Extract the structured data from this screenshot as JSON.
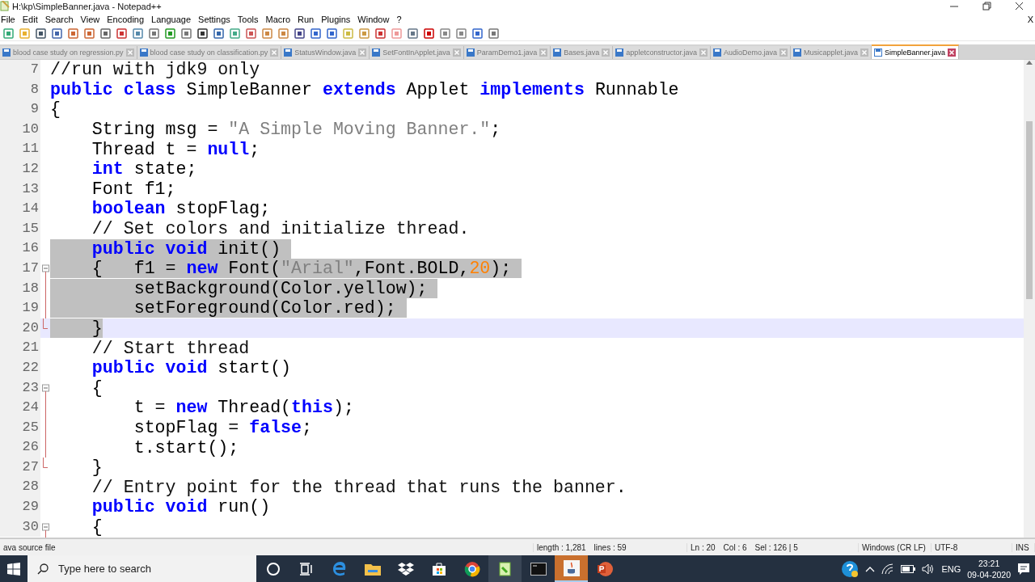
{
  "window": {
    "title": "H:\\kp\\SimpleBanner.java - Notepad++"
  },
  "menu": [
    "File",
    "Edit",
    "Search",
    "View",
    "Encoding",
    "Language",
    "Settings",
    "Tools",
    "Macro",
    "Run",
    "Plugins",
    "Window",
    "?"
  ],
  "doc_close": "X",
  "tabs": [
    {
      "label": "blood case study on regression.py",
      "selected": false
    },
    {
      "label": "blood case study on classification.py",
      "selected": false
    },
    {
      "label": "StatusWindow.java",
      "selected": false
    },
    {
      "label": "SetFontInApplet.java",
      "selected": false
    },
    {
      "label": "ParamDemo1.java",
      "selected": false
    },
    {
      "label": "Bases.java",
      "selected": false
    },
    {
      "label": "appletconstructor.java",
      "selected": false
    },
    {
      "label": "AudioDemo.java",
      "selected": false
    },
    {
      "label": "Musicapplet.java",
      "selected": false
    },
    {
      "label": "SimpleBanner.java",
      "selected": true
    }
  ],
  "lines": [
    {
      "number": "7",
      "selected": false,
      "tokens": [
        {
          "kind": "comment",
          "text": "//run with jdk9 only"
        }
      ]
    },
    {
      "number": "8",
      "selected": false,
      "tokens": [
        {
          "kind": "kw",
          "text": "public class "
        },
        {
          "kind": "plain",
          "text": "SimpleBanner "
        },
        {
          "kind": "kw",
          "text": "extends "
        },
        {
          "kind": "plain",
          "text": "Applet "
        },
        {
          "kind": "kw",
          "text": "implements "
        },
        {
          "kind": "plain",
          "text": "Runnable"
        }
      ]
    },
    {
      "number": "9",
      "selected": false,
      "tokens": [
        {
          "kind": "plain",
          "text": "{"
        }
      ]
    },
    {
      "number": "10",
      "selected": false,
      "tokens": [
        {
          "kind": "plain",
          "text": "    String msg = "
        },
        {
          "kind": "str",
          "text": "\"A Simple Moving Banner.\""
        },
        {
          "kind": "plain",
          "text": ";"
        }
      ]
    },
    {
      "number": "11",
      "selected": false,
      "tokens": [
        {
          "kind": "plain",
          "text": "    Thread t = "
        },
        {
          "kind": "kw",
          "text": "null"
        },
        {
          "kind": "plain",
          "text": ";"
        }
      ]
    },
    {
      "number": "12",
      "selected": false,
      "tokens": [
        {
          "kind": "kw",
          "text": "    int "
        },
        {
          "kind": "plain",
          "text": "state;"
        }
      ]
    },
    {
      "number": "13",
      "selected": false,
      "tokens": [
        {
          "kind": "plain",
          "text": "    Font f1;"
        }
      ]
    },
    {
      "number": "14",
      "selected": false,
      "tokens": [
        {
          "kind": "kw",
          "text": "    boolean "
        },
        {
          "kind": "plain",
          "text": "stopFlag;"
        }
      ]
    },
    {
      "number": "15",
      "selected": false,
      "tokens": [
        {
          "kind": "comment",
          "text": "    // Set colors and initialize thread."
        }
      ]
    },
    {
      "number": "16",
      "selected": true,
      "tokens": [
        {
          "kind": "kw",
          "text": "    public void "
        },
        {
          "kind": "plain",
          "text": "init() "
        }
      ]
    },
    {
      "number": "17",
      "selected": true,
      "fold_start": true,
      "tokens": [
        {
          "kind": "plain",
          "text": "    {   f1 = "
        },
        {
          "kind": "kw",
          "text": "new "
        },
        {
          "kind": "plain",
          "text": "Font("
        },
        {
          "kind": "str",
          "text": "\"Arial\""
        },
        {
          "kind": "plain",
          "text": ",Font.BOLD,"
        },
        {
          "kind": "num",
          "text": "20"
        },
        {
          "kind": "plain",
          "text": "); "
        }
      ]
    },
    {
      "number": "18",
      "selected": true,
      "in_fold": true,
      "tokens": [
        {
          "kind": "plain",
          "text": "        setBackground(Color.yellow); "
        }
      ]
    },
    {
      "number": "19",
      "selected": true,
      "in_fold": true,
      "tokens": [
        {
          "kind": "plain",
          "text": "        setForeground(Color.red); "
        }
      ]
    },
    {
      "number": "20",
      "selected": true,
      "current": true,
      "fold_end": true,
      "tokens": [
        {
          "kind": "plain",
          "text": "    }"
        }
      ]
    },
    {
      "number": "21",
      "selected": false,
      "tokens": [
        {
          "kind": "comment",
          "text": "    // Start thread"
        }
      ]
    },
    {
      "number": "22",
      "selected": false,
      "tokens": [
        {
          "kind": "kw",
          "text": "    public void "
        },
        {
          "kind": "plain",
          "text": "start()"
        }
      ]
    },
    {
      "number": "23",
      "selected": false,
      "fold_start": true,
      "tokens": [
        {
          "kind": "plain",
          "text": "    {"
        }
      ]
    },
    {
      "number": "24",
      "selected": false,
      "in_fold": true,
      "tokens": [
        {
          "kind": "plain",
          "text": "        t = "
        },
        {
          "kind": "kw",
          "text": "new "
        },
        {
          "kind": "plain",
          "text": "Thread("
        },
        {
          "kind": "kw",
          "text": "this"
        },
        {
          "kind": "plain",
          "text": ");"
        }
      ]
    },
    {
      "number": "25",
      "selected": false,
      "in_fold": true,
      "tokens": [
        {
          "kind": "plain",
          "text": "        stopFlag = "
        },
        {
          "kind": "kw",
          "text": "false"
        },
        {
          "kind": "plain",
          "text": ";"
        }
      ]
    },
    {
      "number": "26",
      "selected": false,
      "in_fold": true,
      "tokens": [
        {
          "kind": "plain",
          "text": "        t.start();"
        }
      ]
    },
    {
      "number": "27",
      "selected": false,
      "fold_end": true,
      "tokens": [
        {
          "kind": "plain",
          "text": "    }"
        }
      ]
    },
    {
      "number": "28",
      "selected": false,
      "tokens": [
        {
          "kind": "comment",
          "text": "    // Entry point for the thread that runs the banner."
        }
      ]
    },
    {
      "number": "29",
      "selected": false,
      "tokens": [
        {
          "kind": "kw",
          "text": "    public void "
        },
        {
          "kind": "plain",
          "text": "run()"
        }
      ]
    },
    {
      "number": "30",
      "selected": false,
      "fold_start": true,
      "tokens": [
        {
          "kind": "plain",
          "text": "    {"
        }
      ]
    }
  ],
  "status_bar": {
    "file_type": "ava source file",
    "length": "length : 1,281",
    "lines": "lines : 59",
    "ln": "Ln : 20",
    "col": "Col : 6",
    "sel": "Sel : 126 | 5",
    "eol": "Windows (CR LF)",
    "encoding": "UTF-8",
    "mode": "INS"
  },
  "taskbar": {
    "search": {
      "placeholder": "Type here to search"
    },
    "language": "ENG",
    "time": "23:21",
    "date": "09-04-2020"
  }
}
